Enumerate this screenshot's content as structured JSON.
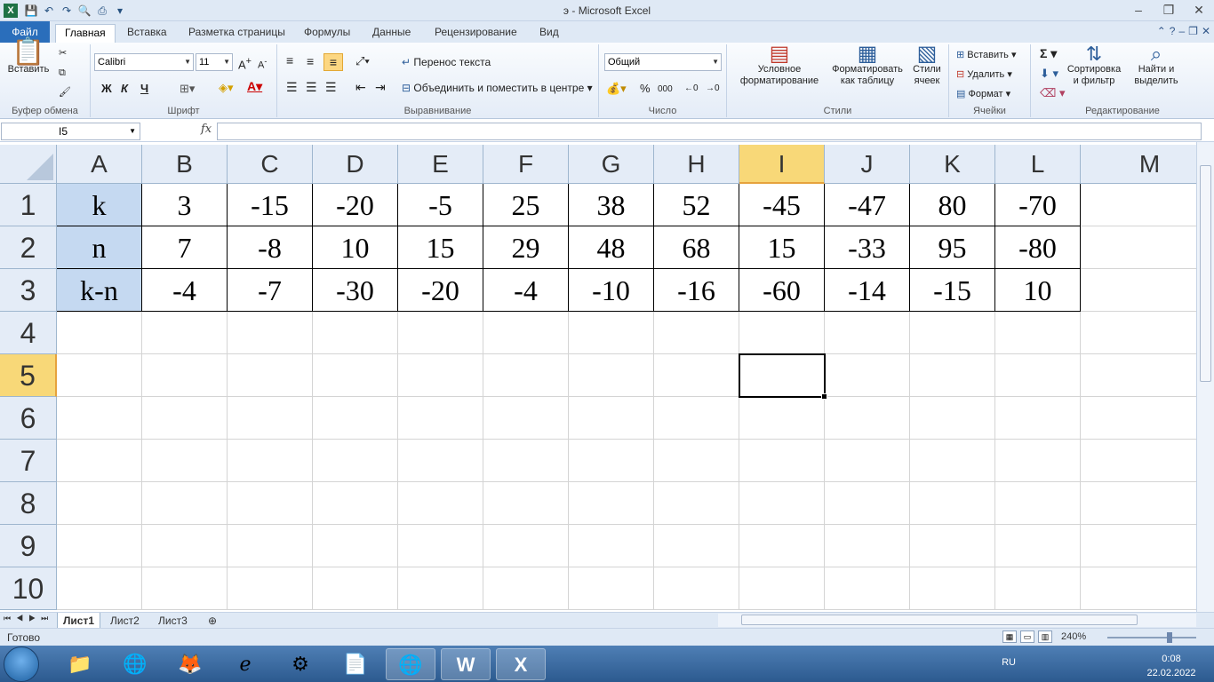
{
  "window": {
    "title": "э  -  Microsoft Excel",
    "app_icon": "X"
  },
  "ribbon_tabs": [
    "Файл",
    "Главная",
    "Вставка",
    "Разметка страницы",
    "Формулы",
    "Данные",
    "Рецензирование",
    "Вид"
  ],
  "clipboard": {
    "paste_label": "Вставить",
    "group_label": "Буфер обмена"
  },
  "font": {
    "name": "Calibri",
    "size": "11",
    "group_label": "Шрифт",
    "bold": "Ж",
    "italic": "К",
    "underline": "Ч"
  },
  "alignment": {
    "wrap_text": "Перенос текста",
    "merge_center": "Объединить и поместить в центре",
    "group_label": "Выравнивание"
  },
  "number": {
    "format": "Общий",
    "group_label": "Число",
    "percent": "%",
    "thousands": "000"
  },
  "styles": {
    "conditional": "Условное форматирование",
    "format_table": "Форматировать как таблицу",
    "cell_styles": "Стили ячеек",
    "group_label": "Стили"
  },
  "cells": {
    "insert": "Вставить",
    "delete": "Удалить",
    "format": "Формат",
    "group_label": "Ячейки"
  },
  "editing": {
    "sort_filter": "Сортировка и фильтр",
    "find_select": "Найти и выделить",
    "group_label": "Редактирование"
  },
  "formula_bar": {
    "name_box": "I5",
    "fx": "fx",
    "value": ""
  },
  "columns": [
    "A",
    "B",
    "C",
    "D",
    "E",
    "F",
    "G",
    "H",
    "I",
    "J",
    "K",
    "L",
    "M"
  ],
  "rows": [
    "1",
    "2",
    "3",
    "4",
    "5",
    "6",
    "7",
    "8",
    "9",
    "10"
  ],
  "table": [
    [
      "k",
      "3",
      "-15",
      "-20",
      "-5",
      "25",
      "38",
      "52",
      "-45",
      "-47",
      "80",
      "-70"
    ],
    [
      "n",
      "7",
      "-8",
      "10",
      "15",
      "29",
      "48",
      "68",
      "15",
      "-33",
      "95",
      "-80"
    ],
    [
      "k-n",
      "-4",
      "-7",
      "-30",
      "-20",
      "-4",
      "-10",
      "-16",
      "-60",
      "-14",
      "-15",
      "10"
    ]
  ],
  "sheets": [
    "Лист1",
    "Лист2",
    "Лист3"
  ],
  "status": {
    "ready": "Готово",
    "zoom": "240%"
  },
  "taskbar": {
    "lang": "RU",
    "time": "0:08",
    "date": "22.02.2022"
  },
  "colors": {
    "accent": "#2a6ebb",
    "selected_header": "#f8d878",
    "label_fill": "#c5d9f1"
  }
}
